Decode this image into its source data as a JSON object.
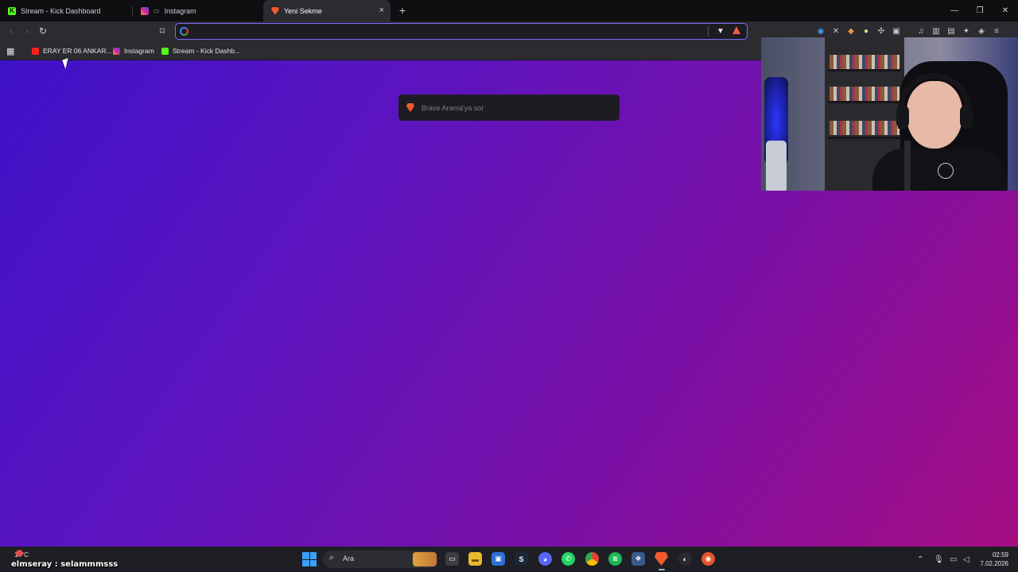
{
  "tabs": [
    {
      "title": "Stream - Kick Dashboard",
      "icon": "kick-icon",
      "active": false
    },
    {
      "title": "Instagram",
      "icon": "instagram-icon",
      "active": false
    },
    {
      "title": "Yeni Sekme",
      "icon": "brave-icon",
      "active": true
    }
  ],
  "toolbar": {
    "url_value": "",
    "new_tab": "+",
    "close": "×"
  },
  "bookmarks": [
    {
      "label": "ERAY ER 06 ANKAR...",
      "icon": "youtube-icon"
    },
    {
      "label": "Instagram",
      "icon": "instagram-icon"
    },
    {
      "label": "Stream - Kick Dashb...",
      "icon": "kick-icon"
    }
  ],
  "suggestion": {
    "label": "Brave Arama'ya sor"
  },
  "taskbar": {
    "weather": "14°C",
    "search_label": "Ara",
    "clock_time": "02:59",
    "clock_date": "7.02.2026"
  },
  "overlay": {
    "chat_line": "elmseray : selammmsss"
  },
  "colors": {
    "accent": "#7b6cff",
    "kick": "#53fc18",
    "brave": "#f25a2d",
    "gradient_start": "#3f12c8",
    "gradient_end": "#a50d82"
  }
}
